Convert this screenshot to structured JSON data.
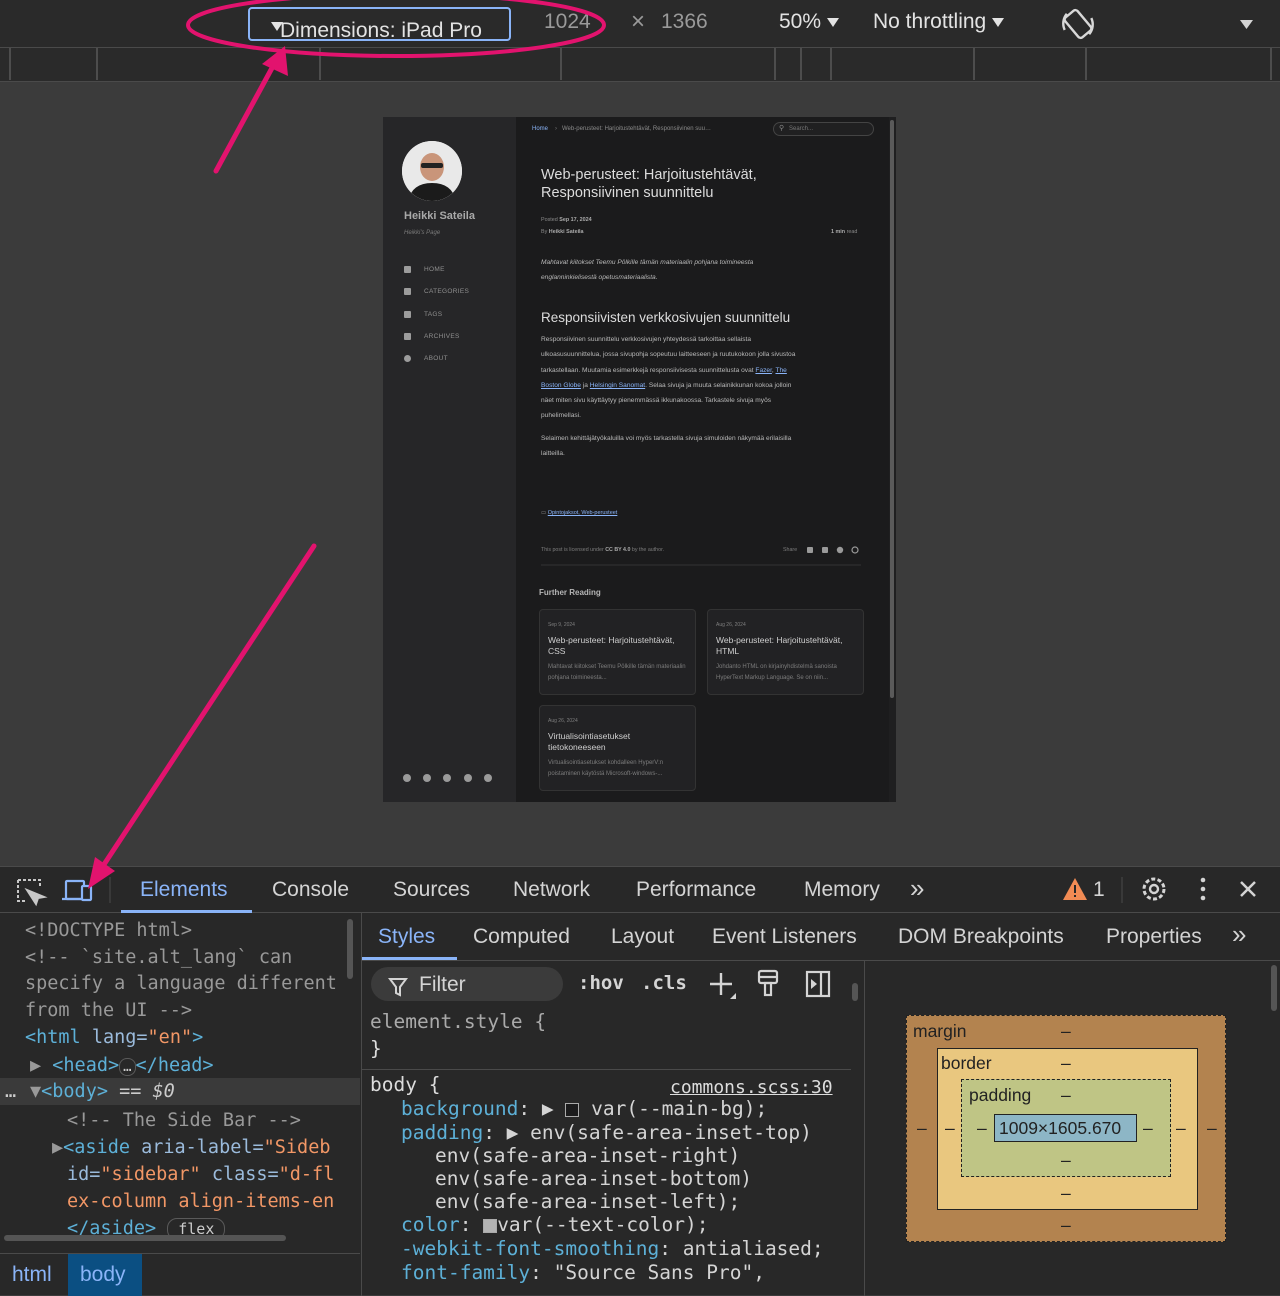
{
  "toolbar": {
    "dimensions_label": "Dimensions: iPad Pro",
    "width": "1024",
    "times": "×",
    "height": "1366",
    "zoom": "50%",
    "throttling": "No throttling"
  },
  "page": {
    "breadcrumb_home": "Home",
    "breadcrumb_sep": "›",
    "breadcrumb_current": "Web-perusteet: Harjoitustehtävät, Responsiivinen suu…",
    "search_placeholder": "Search...",
    "author_name": "Heikki Sateila",
    "author_tagline": "Heikki's Page",
    "nav": [
      {
        "label": "HOME",
        "icon": "home-icon"
      },
      {
        "label": "CATEGORIES",
        "icon": "stream-icon"
      },
      {
        "label": "TAGS",
        "icon": "tags-icon"
      },
      {
        "label": "ARCHIVES",
        "icon": "archive-icon"
      },
      {
        "label": "ABOUT",
        "icon": "info-icon"
      }
    ],
    "title_line1": "Web-perusteet: Harjoitustehtävät,",
    "title_line2": "Responsiivinen suunnittelu",
    "posted_label": "Posted",
    "posted_date": "Sep 17, 2024",
    "by_label": "By",
    "by_author": "Heikki Sateila",
    "read_time": "1 min",
    "read_label": "read",
    "intro_line1": "Mahtavat kiitokset Teemu Pölkille tämän materiaalin pohjana toimineesta",
    "intro_line2": "englanninkielisestä opetusmateriaalista.",
    "section_heading": "Responsiivisten verkkosivujen suunnittelu",
    "p1_line1": "Responsiivinen suunnittelu verkkosivujen yhteydessä tarkoittaa sellaista",
    "p1_line2": "ulkoasusuunnittelua, jossa sivupohja sopeutuu laitteeseen ja ruutukokoon jolla sivustoa",
    "p1_line3": "tarkastellaan. Muutamia esimerkkejä responsiivisesta suunnittelusta ovat",
    "p1_link1": "Fazer",
    "p1_link2": "The",
    "p1_link3": "Boston Globe",
    "p1_and": "ja",
    "p1_link4": "Helsingin Sanomat",
    "p1_line4_rest": ". Selaa sivuja ja muuta selainikkunan kokoa jolloin",
    "p1_line5": "näet miten sivu käyttäytyy pienemmässä ikkunakoossa. Tarkastele sivuja myös",
    "p1_line6": "puhelimellasi.",
    "p2_line1": "Selaimen kehittäjätyökaluilla voi myös tarkastella sivuja simuloiden näkymää erilaisilla",
    "p2_line2": "laitteilla.",
    "categories": "Opintojaksot, Web-perusteet",
    "license_pre": "This post is licensed under",
    "license": "CC BY 4.0",
    "license_post": "by the author.",
    "share_label": "Share",
    "further_reading": "Further Reading",
    "cards": [
      {
        "date": "Sep 9, 2024",
        "title": "Web-perusteet: Harjoitustehtävät, CSS",
        "excerpt": "Mahtavat kiitokset Teemu Pölkille tämän materiaalin pohjana toimineesta..."
      },
      {
        "date": "Aug 26, 2024",
        "title": "Web-perusteet: Harjoitustehtävät, HTML",
        "excerpt": "Johdanto HTML on kirjainyhdistelmä sanoista HyperText Markup Language. Se on niin..."
      },
      {
        "date": "Aug 26, 2024",
        "title": "Virtualisointiasetukset tietokoneeseen",
        "excerpt": "Virtualisointiasetukset kohdalleen HyperV:n poistaminen käytöstä Microsoft-windows-..."
      }
    ]
  },
  "devtools": {
    "tabs": [
      "Elements",
      "Console",
      "Sources",
      "Network",
      "Performance",
      "Memory"
    ],
    "more_tabs": "»",
    "warning_count": "1",
    "dom_lines": {
      "doctype": "<!DOCTYPE html>",
      "comment1": "<!-- `site.alt_lang` can",
      "comment2": "specify a language different",
      "comment3": "from the UI -->",
      "html_open": "<html",
      "html_attr": "lang=",
      "html_val": "\"en\"",
      "head": "<head>",
      "head_ellipsis": "…",
      "head_close": "</head>",
      "body": "<body>",
      "body_eq": "== $0",
      "comment_sidebar": "<!-- The Side Bar -->",
      "aside_open": "<aside",
      "aside_attr1": "aria-label=",
      "aside_val1": "\"Sideb",
      "aside_attr2": "id=",
      "aside_val2": "\"sidebar\"",
      "aside_attr3": "class=",
      "aside_val3": "\"d-fl",
      "aside_val3b": "ex-column align-items-en",
      "aside_close": "</aside>",
      "flex_badge": "flex"
    },
    "crumbs": [
      "html",
      "body"
    ],
    "styles_tabs": [
      "Styles",
      "Computed",
      "Layout",
      "Event Listeners",
      "DOM Breakpoints",
      "Properties"
    ],
    "filter_placeholder": "Filter",
    "hov": ":hov",
    "cls": ".cls",
    "styles": {
      "element_style": "element.style {",
      "close_brace": "}",
      "body_selector": "body {",
      "source": "commons.scss:30",
      "background_prop": "background",
      "background_val": "var(--main-bg);",
      "padding_prop": "padding",
      "padding_val1": "env(safe-area-inset-top)",
      "padding_val2": "env(safe-area-inset-right)",
      "padding_val3": "env(safe-area-inset-bottom)",
      "padding_val4": "env(safe-area-inset-left);",
      "color_prop": "color",
      "color_val": "var(--text-color);",
      "smoothing_prop": "-webkit-font-smoothing",
      "smoothing_val": "antialiased;",
      "font_prop": "font-family",
      "font_val": "\"Source Sans Pro\","
    },
    "box_model": {
      "margin": "margin",
      "border": "border",
      "padding": "padding",
      "dash": "–",
      "content": "1009×1605.670"
    }
  },
  "colors": {
    "annotation": "#e2136e",
    "accent": "#8ab4f8",
    "margin_box": "#b3834f",
    "border_box": "#e9c77f",
    "padding_box": "#bfc585",
    "content_box": "#8db6c6"
  }
}
